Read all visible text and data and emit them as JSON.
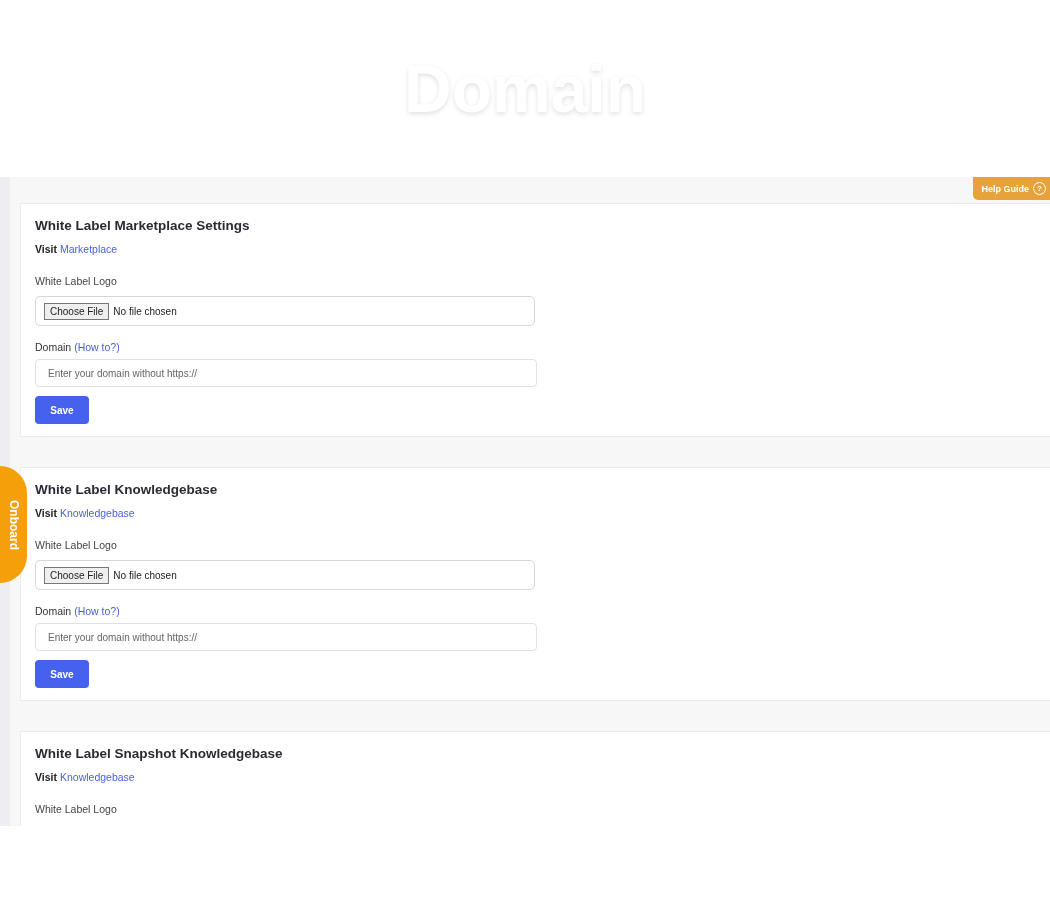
{
  "page_title": "Domain",
  "help_guide": {
    "label": "Help Guide",
    "icon": "?"
  },
  "onboard": {
    "label": "Onboard"
  },
  "sections": [
    {
      "title": "White Label Marketplace Settings",
      "visit_label": "Visit",
      "visit_link": "Marketplace",
      "logo_label": "White Label Logo",
      "file_button": "Choose File",
      "file_status": "No file chosen",
      "domain_label": "Domain",
      "how_to": "(How to?)",
      "placeholder": "Enter your domain without https://",
      "save": "Save"
    },
    {
      "title": "White Label Knowledgebase",
      "visit_label": "Visit",
      "visit_link": "Knowledgebase",
      "logo_label": "White Label Logo",
      "file_button": "Choose File",
      "file_status": "No file chosen",
      "domain_label": "Domain",
      "how_to": "(How to?)",
      "placeholder": "Enter your domain without https://",
      "save": "Save"
    },
    {
      "title": "White Label Snapshot Knowledgebase",
      "visit_label": "Visit",
      "visit_link": "Knowledgebase",
      "logo_label": "White Label Logo"
    }
  ]
}
